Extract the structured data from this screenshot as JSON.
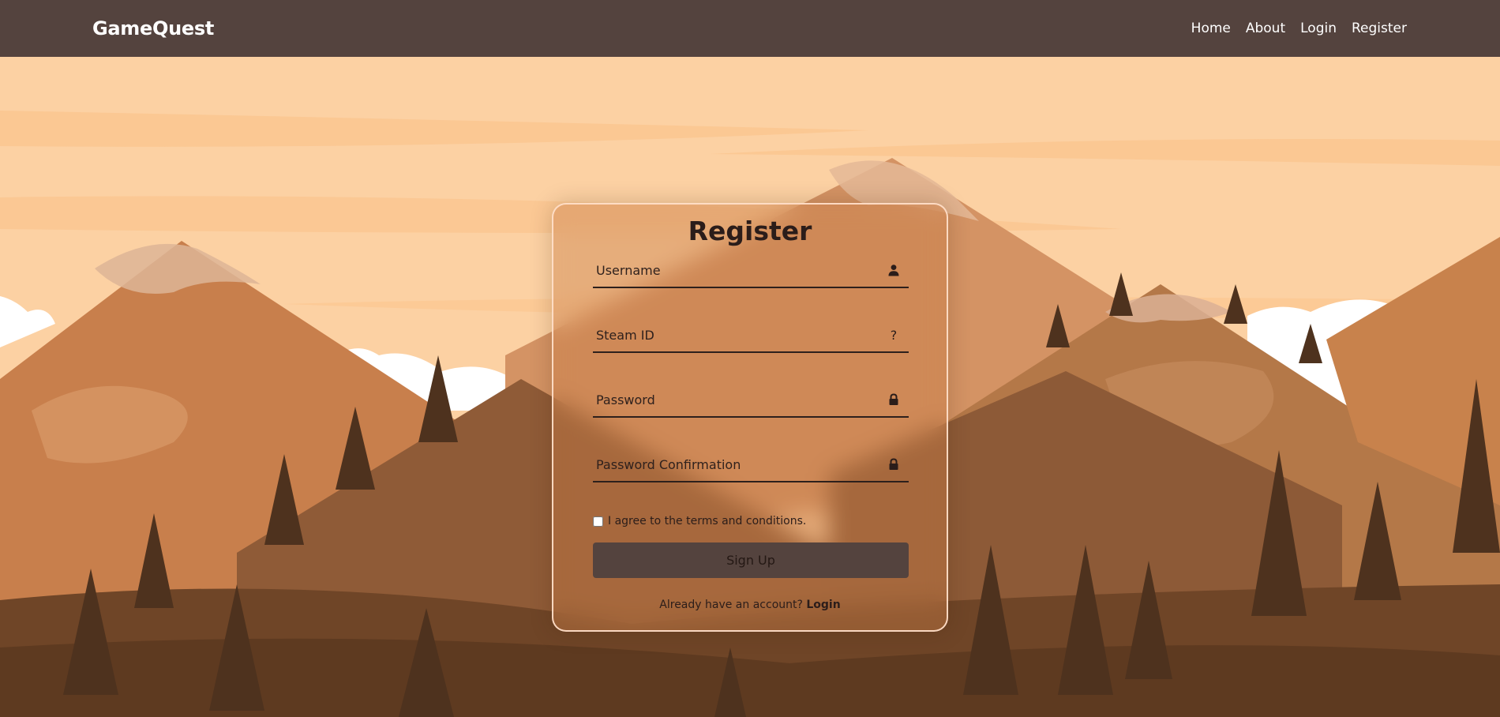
{
  "navbar": {
    "brand": "GameQuest",
    "links": [
      {
        "label": "Home"
      },
      {
        "label": "About"
      },
      {
        "label": "Login"
      },
      {
        "label": "Register"
      }
    ]
  },
  "form": {
    "title": "Register",
    "fields": [
      {
        "placeholder": "Username",
        "icon": "user-icon"
      },
      {
        "placeholder": "Steam ID",
        "icon": "question-icon",
        "icon_text": "?"
      },
      {
        "placeholder": "Password",
        "icon": "lock-icon"
      },
      {
        "placeholder": "Password Confirmation",
        "icon": "lock-icon"
      }
    ],
    "terms_label": "I agree to the terms and conditions.",
    "terms_checked": false,
    "submit_label": "Sign Up",
    "login_prompt": "Already have an account?",
    "login_link": "Login"
  },
  "colors": {
    "navbar": "#54433e",
    "sky": "#fcd1a3",
    "button": "#54433e",
    "text": "#2b1d1a"
  }
}
